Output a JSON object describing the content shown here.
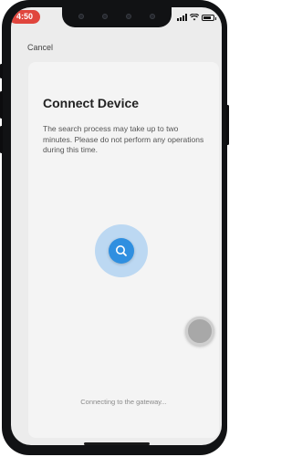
{
  "status_bar": {
    "time": "4:50",
    "time_color": "#e0453d",
    "signal_icon": "signal-bars-icon",
    "wifi_icon": "wifi-icon",
    "battery_icon": "battery-icon"
  },
  "nav": {
    "cancel_label": "Cancel"
  },
  "card": {
    "title": "Connect Device",
    "description": "The search process may take up to two minutes. Please do not perform any operations during this time.",
    "search_icon": "search-icon",
    "accent_color": "#2f8fe0",
    "status_text": "Connecting to the gateway..."
  },
  "overlay": {
    "assistive_touch_icon": "assistive-touch-icon"
  }
}
